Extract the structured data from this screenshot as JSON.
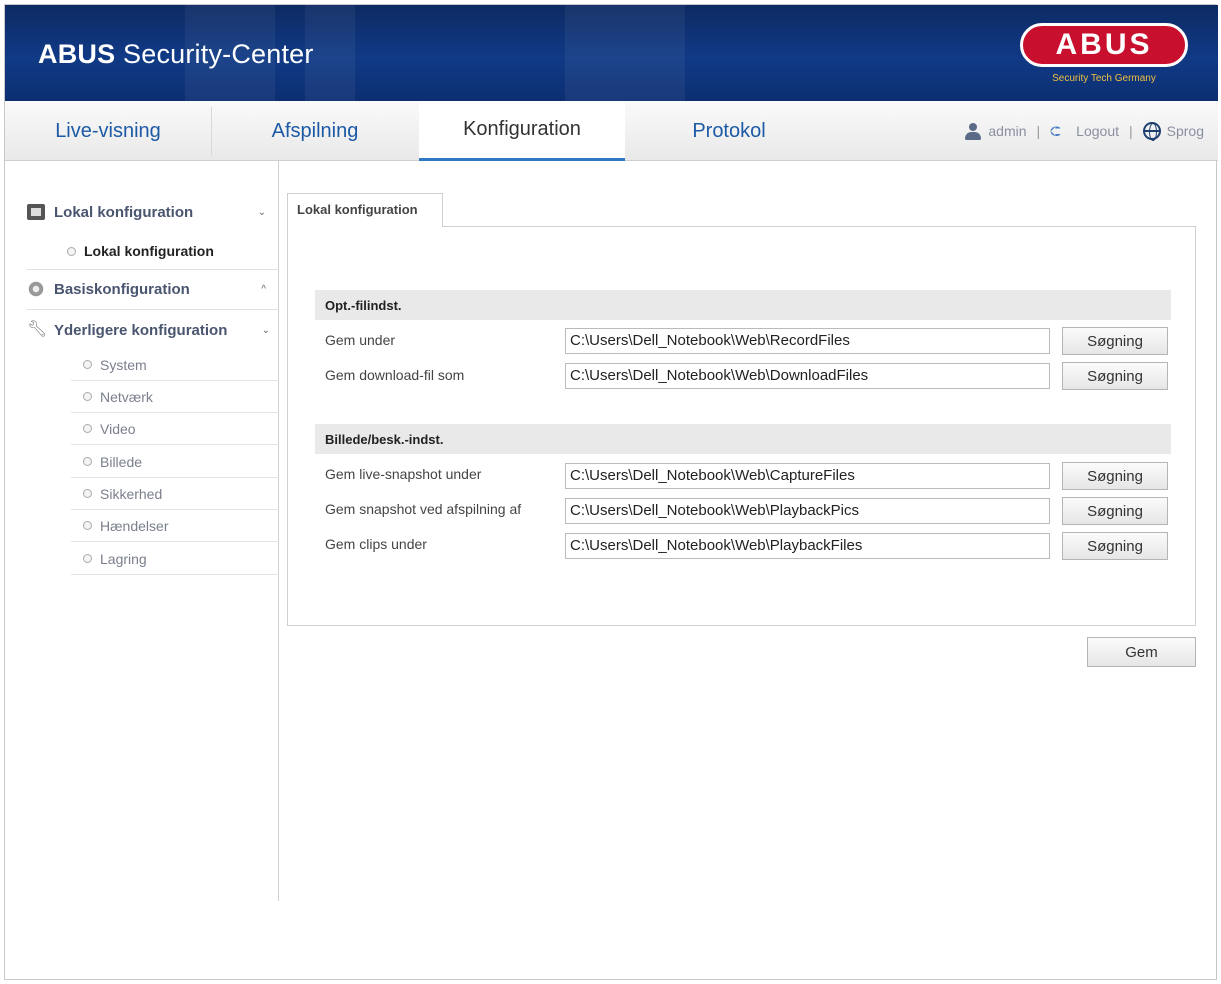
{
  "header": {
    "brand_bold": "ABUS",
    "brand_rest": " Security-Center",
    "logo_text": "ABUS",
    "logo_tagline": "Security Tech Germany",
    "colors": {
      "banner": "#103a86",
      "logo_red": "#c8102e",
      "tab_text": "#1d5aa6",
      "active_underline": "#2f78c6"
    }
  },
  "nav": {
    "tabs": [
      {
        "label": "Live-visning",
        "active": false
      },
      {
        "label": "Afspilning",
        "active": false
      },
      {
        "label": "Konfiguration",
        "active": true
      },
      {
        "label": "Protokol",
        "active": false
      }
    ],
    "user": "admin",
    "logout": "Logout",
    "language": "Sprog",
    "icons": {
      "user": "user-icon",
      "logout": "logout-icon",
      "language": "globe-icon"
    }
  },
  "sidebar": {
    "groups": [
      {
        "label": "Lokal konfiguration",
        "chevron": "⌄",
        "icon": "folder-icon"
      },
      {
        "label": "Basiskonfiguration",
        "chevron": "^",
        "icon": "gear-icon"
      },
      {
        "label": "Yderligere konfiguration",
        "chevron": "⌄",
        "icon": "wrench-icon"
      }
    ],
    "local_items": [
      "Lokal konfiguration"
    ],
    "advanced_items": [
      "System",
      "Netværk",
      "Video",
      "Billede",
      "Sikkerhed",
      "Hændelser",
      "Lagring"
    ]
  },
  "content": {
    "tab_label": "Lokal konfiguration",
    "sections": [
      {
        "title": "Opt.-filindst.",
        "rows": [
          {
            "label": "Gem under",
            "value": "C:\\Users\\Dell_Notebook\\Web\\RecordFiles",
            "button": "Søgning"
          },
          {
            "label": "Gem download-fil som",
            "value": "C:\\Users\\Dell_Notebook\\Web\\DownloadFiles",
            "button": "Søgning"
          }
        ]
      },
      {
        "title": "Billede/besk.-indst.",
        "rows": [
          {
            "label": "Gem live-snapshot under",
            "value": "C:\\Users\\Dell_Notebook\\Web\\CaptureFiles",
            "button": "Søgning"
          },
          {
            "label": "Gem snapshot ved afspilning af",
            "value": "C:\\Users\\Dell_Notebook\\Web\\PlaybackPics",
            "button": "Søgning"
          },
          {
            "label": "Gem clips under",
            "value": "C:\\Users\\Dell_Notebook\\Web\\PlaybackFiles",
            "button": "Søgning"
          }
        ]
      }
    ],
    "save_label": "Gem"
  }
}
